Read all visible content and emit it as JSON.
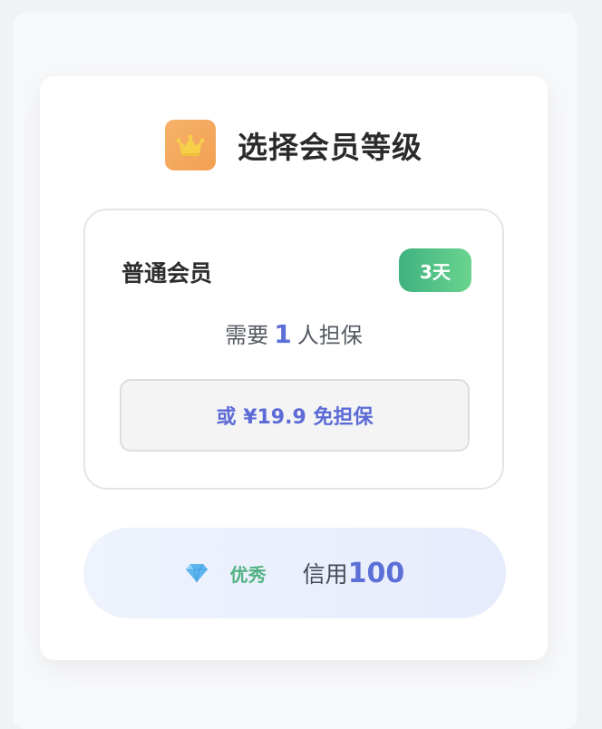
{
  "header": {
    "title": "选择会员等级",
    "icon": "crown-icon"
  },
  "tier": {
    "name": "普通会员",
    "duration_badge": "3天",
    "guarantee_prefix": "需要",
    "guarantee_count": "1",
    "guarantee_suffix": "人担保",
    "pay_button_label": "或 ¥19.9 免担保"
  },
  "credit": {
    "icon": "diamond-icon",
    "level": "优秀",
    "label": "信用",
    "score": "100"
  },
  "colors": {
    "accent": "#5b6fd6",
    "badge_green": "#3fb27f",
    "crown_tile": "#f3a052"
  }
}
